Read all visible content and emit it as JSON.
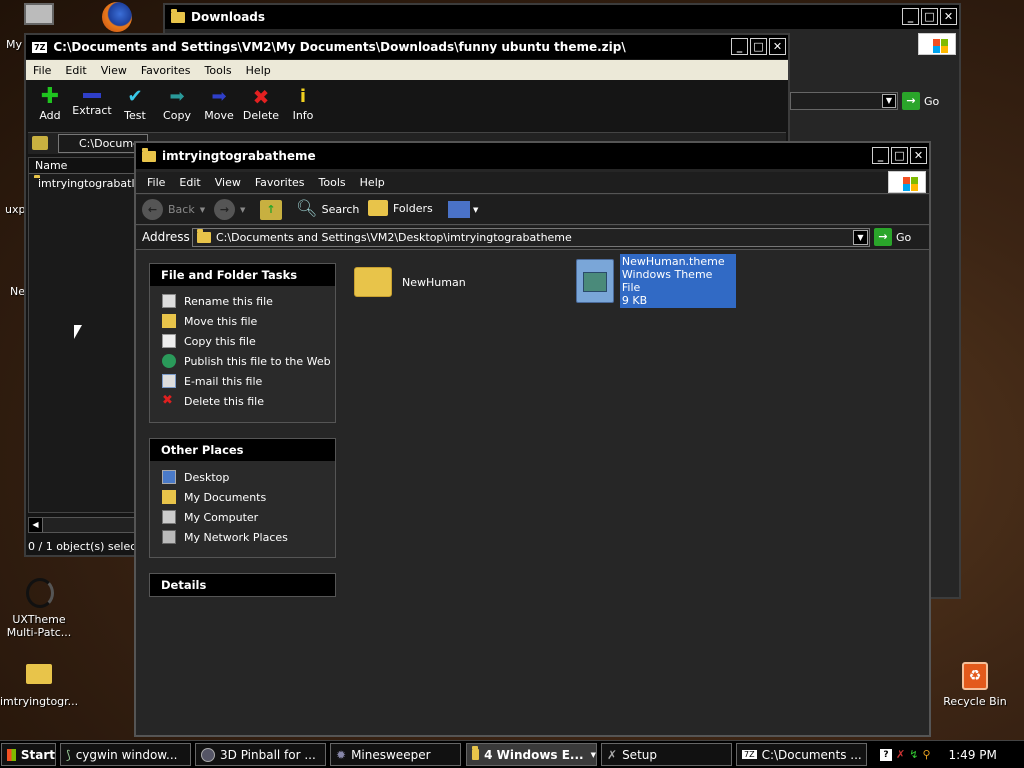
{
  "desktop": {
    "icons": [
      {
        "label": "My"
      },
      {
        "label": "uxp"
      },
      {
        "label": "Ne"
      },
      {
        "label": "UXTheme Multi-Patc..."
      },
      {
        "label": "imtryingtogr..."
      },
      {
        "label": "Recycle Bin"
      }
    ]
  },
  "downloads_window": {
    "title": "Downloads",
    "go_label": "Go"
  },
  "zip_window": {
    "title": "C:\\Documents and Settings\\VM2\\My Documents\\Downloads\\funny ubuntu theme.zip\\",
    "app_badge": "7Z",
    "menu": [
      "File",
      "Edit",
      "View",
      "Favorites",
      "Tools",
      "Help"
    ],
    "toolbar": [
      "Add",
      "Extract",
      "Test",
      "Copy",
      "Move",
      "Delete",
      "Info"
    ],
    "path": "C:\\Docume",
    "column_name": "Name",
    "row": "imtryingtograbatl",
    "status": "0 / 1 object(s) selecte"
  },
  "explorer": {
    "title": "imtryingtograbatheme",
    "menu": [
      "File",
      "Edit",
      "View",
      "Favorites",
      "Tools",
      "Help"
    ],
    "toolbar": {
      "back": "Back",
      "search": "Search",
      "folders": "Folders"
    },
    "address_label": "Address",
    "address_value": "C:\\Documents and Settings\\VM2\\Desktop\\imtryingtograbatheme",
    "go_label": "Go",
    "file_tasks": {
      "header": "File and Folder Tasks",
      "items": [
        "Rename this file",
        "Move this file",
        "Copy this file",
        "Publish this file to the Web",
        "E-mail this file",
        "Delete this file"
      ]
    },
    "other_places": {
      "header": "Other Places",
      "items": [
        "Desktop",
        "My Documents",
        "My Computer",
        "My Network Places"
      ]
    },
    "details": {
      "header": "Details"
    },
    "items": [
      {
        "name": "NewHuman"
      },
      {
        "name": "NewHuman.theme",
        "type": "Windows Theme File",
        "size": "9 KB"
      }
    ]
  },
  "taskbar": {
    "start": "Start",
    "buttons": [
      "cygwin window...",
      "3D Pinball for ...",
      "Minesweeper",
      "4 Windows E...",
      "Setup",
      "C:\\Documents ..."
    ],
    "clock": "1:49 PM"
  },
  "colors": {
    "selection": "#316ac5",
    "go_green": "#2aa52a",
    "folder": "#e8c44a"
  }
}
